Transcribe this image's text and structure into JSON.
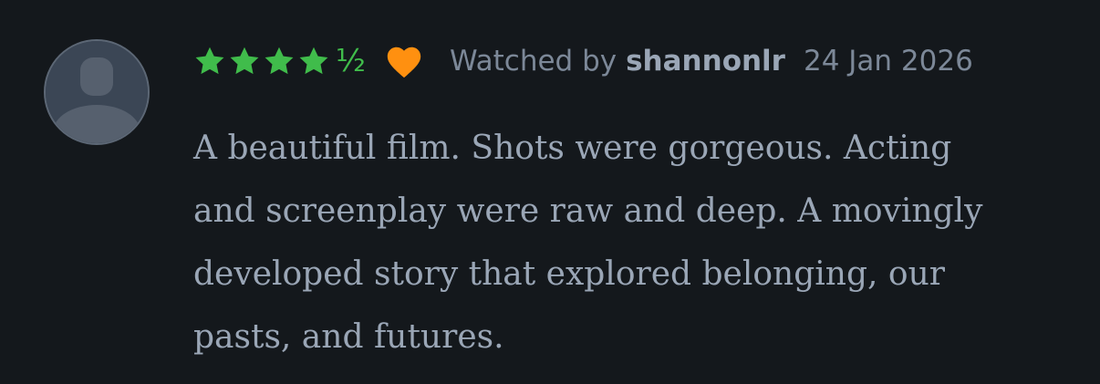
{
  "review": {
    "rating": 4.5,
    "rating_half_glyph": "½",
    "liked": true,
    "watched_prefix": "Watched by",
    "username": "shannonlr",
    "date": "24 Jan 2026",
    "text": "A beautiful film.  Shots were gorgeous.  Acting\nand screenplay were raw and deep.  A movingly\ndeveloped story that explored belonging, our\npasts, and futures."
  },
  "colors": {
    "background": "#14181c",
    "star": "#40bc4b",
    "heart": "#ff9010",
    "meta_text": "#7c8898",
    "body_text": "#9aa6b6"
  },
  "icons": {
    "avatar": "avatar-placeholder-icon",
    "star": "star-icon",
    "like": "heart-icon"
  }
}
